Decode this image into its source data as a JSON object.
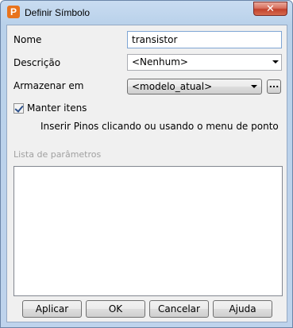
{
  "window": {
    "title": "Definir Símbolo",
    "app_icon_letter": "P",
    "close_glyph": "✕"
  },
  "form": {
    "nome_label": "Nome",
    "nome_value": "transistor",
    "descricao_label": "Descrição",
    "descricao_value": "<Nenhum>",
    "armazenar_label": "Armazenar em",
    "armazenar_value": "<modelo_atual>",
    "browse_label": "...",
    "manter_label": "Manter itens",
    "manter_checked": true,
    "hint": "Inserir Pinos clicando ou usando o menu de ponto",
    "param_list_label": "Lista de parâmetros"
  },
  "buttons": {
    "apply": "Aplicar",
    "ok": "OK",
    "cancel": "Cancelar",
    "help": "Ajuda"
  },
  "colors": {
    "app_icon": "#e8731c",
    "close_button": "#c1412c",
    "disabled_text": "#a0a0a0"
  }
}
